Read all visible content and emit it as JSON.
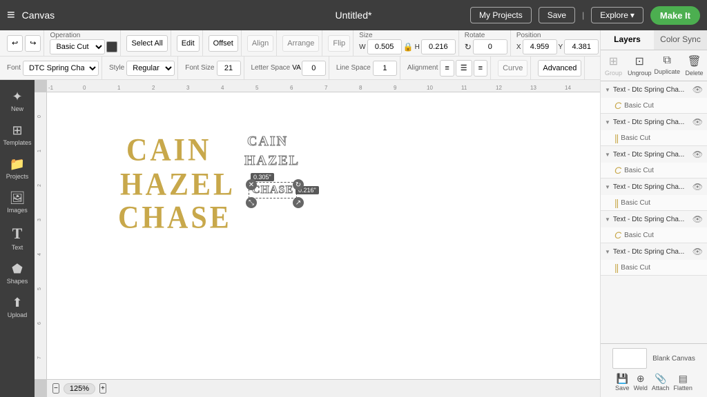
{
  "topbar": {
    "menu_icon": "≡",
    "app_title": "Canvas",
    "doc_title": "Untitled*",
    "my_projects_label": "My Projects",
    "save_label": "Save",
    "explore_label": "Explore",
    "make_it_label": "Make It"
  },
  "toolbar": {
    "operation_label": "Operation",
    "operation_value": "Basic Cut",
    "select_all_label": "Select All",
    "edit_label": "Edit",
    "offset_label": "Offset",
    "align_label": "Align",
    "arrange_label": "Arrange",
    "flip_label": "Flip",
    "size_label": "Size",
    "w_label": "W",
    "w_value": "0.505",
    "h_label": "H",
    "h_value": "0.216",
    "rotate_label": "Rotate",
    "rotate_value": "0",
    "position_label": "Position",
    "x_label": "X",
    "x_value": "4.959",
    "y_label": "Y",
    "y_value": "4.381"
  },
  "toolbar2": {
    "font_label": "Font",
    "font_value": "DTC Spring Charm...",
    "style_label": "Style",
    "style_value": "Regular",
    "font_size_label": "Font Size",
    "font_size_value": "21",
    "letter_space_label": "Letter Space",
    "letter_space_value": "0",
    "line_space_label": "Line Space",
    "line_space_value": "1",
    "alignment_label": "Alignment",
    "curve_label": "Curve",
    "advanced_label": "Advanced"
  },
  "canvas": {
    "zoom_label": "125%",
    "text_cain_filled": "CAIN",
    "text_hazel_filled": "HAZEL",
    "text_chase_filled": "CHASE",
    "text_cain_outline": "CAIN",
    "text_hazel_outline": "HAZEL",
    "text_chase_outline": "CHASE",
    "size_w": "0.305\"",
    "size_h": "0.216\""
  },
  "right_panel": {
    "tab_layers": "Layers",
    "tab_color_sync": "Color Sync",
    "action_group": "Group",
    "action_ungroup": "Ungroup",
    "action_duplicate": "Duplicate",
    "action_delete": "Delete",
    "layers": [
      {
        "name": "Text - Dtc Spring Cha...",
        "sub": "Basic Cut",
        "visible": true,
        "sub_icon": "C"
      },
      {
        "name": "Text - Dtc Spring Cha...",
        "sub": "Basic Cut",
        "visible": true,
        "sub_icon": "||"
      },
      {
        "name": "Text - Dtc Spring Cha...",
        "sub": "Basic Cut",
        "visible": true,
        "sub_icon": "C"
      },
      {
        "name": "Text - Dtc Spring Cha...",
        "sub": "Basic Cut",
        "visible": true,
        "sub_icon": "||"
      },
      {
        "name": "Text - Dtc Spring Cha...",
        "sub": "Basic Cut",
        "visible": true,
        "sub_icon": "C"
      },
      {
        "name": "Text - Dtc Spring Cha...",
        "sub": "Basic Cut",
        "visible": true,
        "sub_icon": "||"
      }
    ],
    "blank_canvas_label": "Blank Canvas",
    "btn_save": "Save",
    "btn_weld": "Weld",
    "btn_attach": "Attach",
    "btn_flatten": "Flatten"
  },
  "ruler": {
    "ticks": [
      "-1",
      "0",
      "1",
      "2",
      "3",
      "4",
      "5",
      "6",
      "7",
      "8",
      "9",
      "10",
      "11",
      "12",
      "13",
      "14"
    ]
  },
  "sidebar": {
    "items": [
      {
        "icon": "✦",
        "label": "New"
      },
      {
        "icon": "🔧",
        "label": "Templates"
      },
      {
        "icon": "📁",
        "label": "Projects"
      },
      {
        "icon": "🖼",
        "label": "Images"
      },
      {
        "icon": "T",
        "label": "Text"
      },
      {
        "icon": "⬟",
        "label": "Shapes"
      },
      {
        "icon": "⬆",
        "label": "Upload"
      }
    ]
  }
}
